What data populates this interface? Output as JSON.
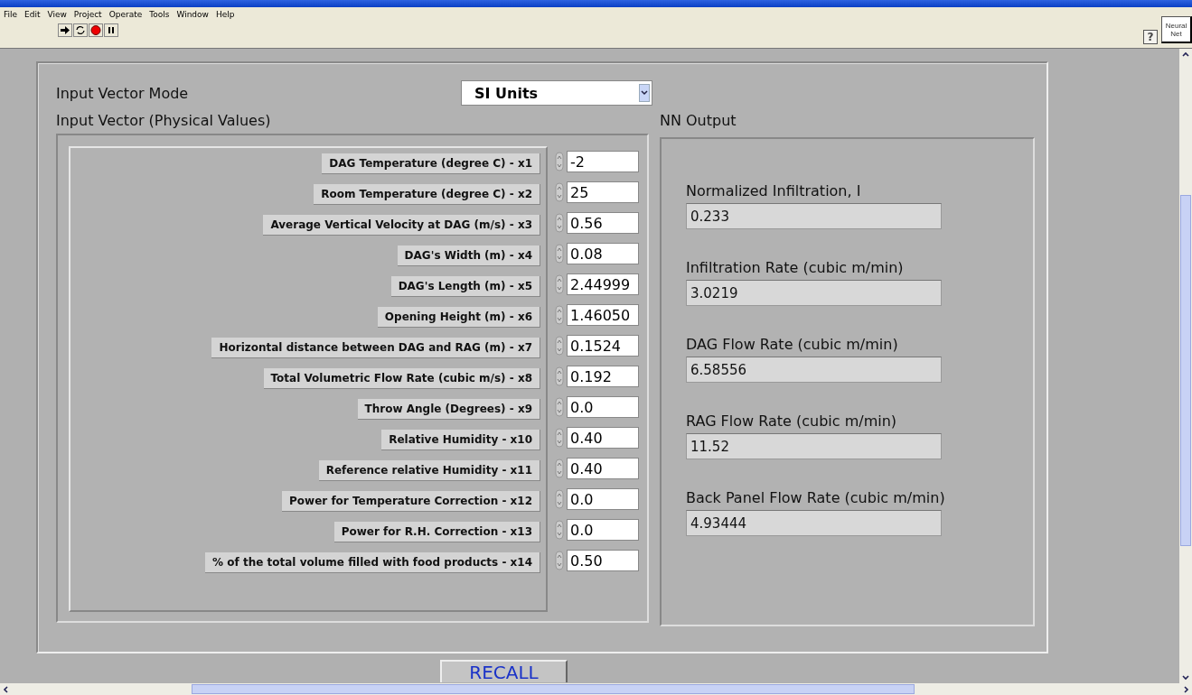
{
  "menu": [
    "File",
    "Edit",
    "View",
    "Project",
    "Operate",
    "Tools",
    "Window",
    "Help"
  ],
  "help_button": "?",
  "neural_net_tab": "Neural Net",
  "mode": {
    "label": "Input Vector Mode",
    "value": "SI Units"
  },
  "inputs": {
    "title": "Input Vector (Physical Values)",
    "rows": [
      {
        "label": "DAG Temperature (degree C) -  x1",
        "value": "-2"
      },
      {
        "label": "Room Temperature (degree C) - x2",
        "value": "25"
      },
      {
        "label": "Average Vertical Velocity at DAG (m/s) -  x3",
        "value": "0.56"
      },
      {
        "label": "DAG's Width (m) -  x4",
        "value": "0.08"
      },
      {
        "label": "DAG's Length (m) - x5",
        "value": "2.44999"
      },
      {
        "label": "Opening Height (m) -  x6",
        "value": "1.46050"
      },
      {
        "label": "Horizontal distance between DAG and RAG  (m) -  x7",
        "value": "0.1524"
      },
      {
        "label": "Total Volumetric Flow Rate (cubic m/s) - x8",
        "value": "0.192"
      },
      {
        "label": "Throw Angle (Degrees) -  x9",
        "value": "0.0"
      },
      {
        "label": "Relative Humidity -  x10",
        "value": "0.40"
      },
      {
        "label": "Reference relative Humidity -  x11",
        "value": "0.40"
      },
      {
        "label": "Power for Temperature Correction -  x12",
        "value": "0.0"
      },
      {
        "label": "Power for R.H. Correction -  x13",
        "value": "0.0"
      },
      {
        "label": "% of the total volume filled with food products - x14",
        "value": "0.50"
      }
    ]
  },
  "outputs": {
    "title": "NN Output",
    "fields": [
      {
        "label": "Normalized Infiltration, I",
        "value": "0.233"
      },
      {
        "label": "Infiltration Rate (cubic m/min)",
        "value": "3.0219"
      },
      {
        "label": "DAG Flow Rate (cubic m/min)",
        "value": "6.58556"
      },
      {
        "label": "RAG Flow Rate (cubic m/min)",
        "value": "11.52"
      },
      {
        "label": "Back Panel Flow Rate (cubic m/min)",
        "value": "4.93444"
      }
    ]
  },
  "recall_button": "RECALL"
}
